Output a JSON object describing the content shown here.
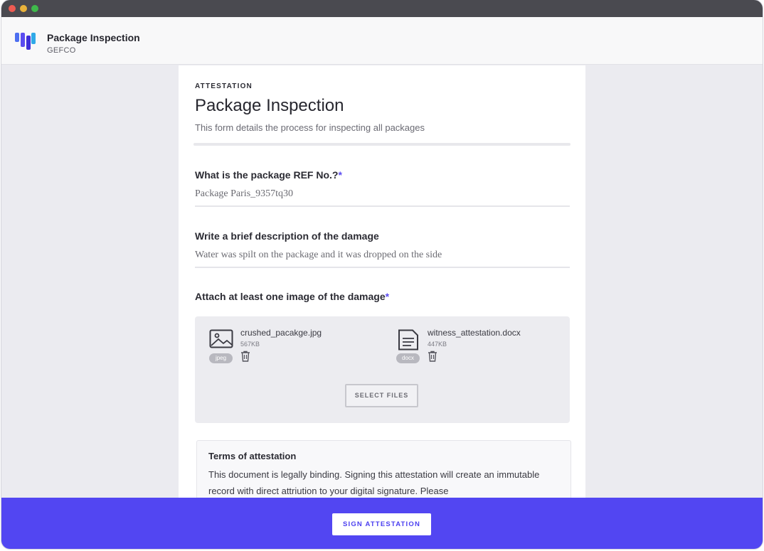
{
  "app": {
    "title": "Package Inspection",
    "subtitle": "GEFCO"
  },
  "form": {
    "eyebrow": "ATTESTATION",
    "title": "Package Inspection",
    "description": "This form details the process for inspecting all packages"
  },
  "questions": [
    {
      "label": "What is the package REF No.?",
      "required_marker": "*",
      "value": "Package Paris_9357tq30"
    },
    {
      "label": "Write a brief description of the damage",
      "value": "Water was spilt on the package and it was dropped on the side"
    },
    {
      "label": "Attach at least one image of the damage",
      "required_marker": "*"
    }
  ],
  "attachments": [
    {
      "name": "crushed_pacakge.jpg",
      "size": "567KB",
      "badge": "jpeg",
      "icon": "image-file-icon"
    },
    {
      "name": "witness_attestation.docx",
      "size": "447KB",
      "badge": "docx",
      "icon": "document-file-icon"
    }
  ],
  "select_files_label": "SELECT FILES",
  "terms": {
    "title": "Terms of attestation",
    "text": "This document is legally binding. Signing this attestation will create an immutable record with direct attriution to your digital signature. Please"
  },
  "footer": {
    "sign_label": "SIGN ATTESTATION"
  },
  "colors": {
    "accent": "#5246f2",
    "required": "#5b4cf0",
    "window_chrome": "#4a4a50"
  }
}
